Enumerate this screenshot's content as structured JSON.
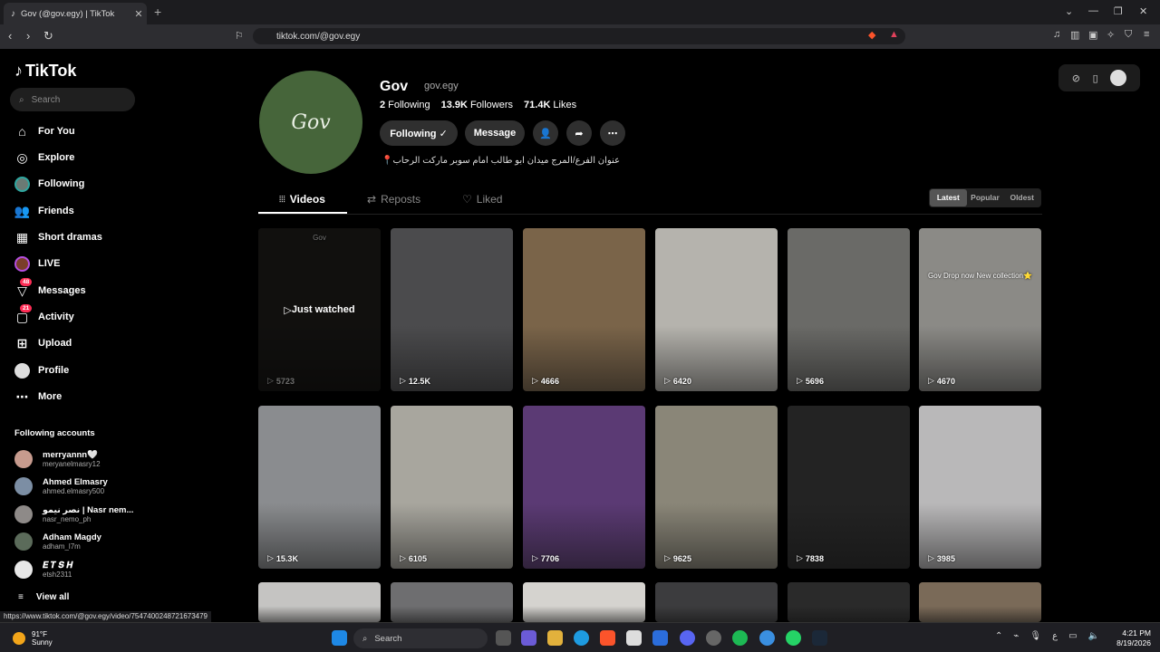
{
  "browser": {
    "tab_title": "Gov (@gov.egy) | TikTok",
    "url": "tiktok.com/@gov.egy"
  },
  "sidebar": {
    "logo": "TikTok",
    "search_placeholder": "Search",
    "nav": [
      {
        "label": "For You",
        "icon": "home-icon"
      },
      {
        "label": "Explore",
        "icon": "compass-icon"
      },
      {
        "label": "Following",
        "icon": "following-avatar-icon"
      },
      {
        "label": "Friends",
        "icon": "friends-icon"
      },
      {
        "label": "Short dramas",
        "icon": "film-icon"
      },
      {
        "label": "LIVE",
        "icon": "live-icon"
      },
      {
        "label": "Messages",
        "icon": "messages-icon",
        "badge": "48"
      },
      {
        "label": "Activity",
        "icon": "activity-icon",
        "badge": "21"
      },
      {
        "label": "Upload",
        "icon": "upload-icon"
      },
      {
        "label": "Profile",
        "icon": "profile-avatar-icon"
      },
      {
        "label": "More",
        "icon": "more-icon"
      }
    ],
    "following_title": "Following accounts",
    "accounts": [
      {
        "name": "merryannn🤍",
        "handle": "meryanelmasry12"
      },
      {
        "name": "Ahmed Elmasry",
        "handle": "ahmed.elmasry500"
      },
      {
        "name": "نصر نيمو | Nasr nem...",
        "handle": "nasr_nemo_ph"
      },
      {
        "name": "Adham Magdy",
        "handle": "adham_l7m"
      },
      {
        "name": "𝑬 𝑻 𝑺 𝑯",
        "handle": "etsh2311"
      }
    ],
    "view_all": "View all"
  },
  "status_url": "https://www.tiktok.com/@gov.egy/video/7547400248721673479",
  "profile": {
    "avatar_text": "Gov",
    "name": "Gov",
    "handle": "gov.egy",
    "following_count": "2",
    "following_label": "Following",
    "followers_count": "13.9K",
    "followers_label": "Followers",
    "likes_count": "71.4K",
    "likes_label": "Likes",
    "btn_following": "Following ✓",
    "btn_message": "Message",
    "bio": "📍عنوان الفرع/المرج ميدان ابو طالب امام سوبر ماركت الرحاب"
  },
  "tabs": {
    "videos": "Videos",
    "reposts": "Reposts",
    "liked": "Liked"
  },
  "sort": {
    "options": [
      "Latest",
      "Popular",
      "Oldest"
    ],
    "active": "Latest"
  },
  "videos": [
    {
      "views": "5723",
      "just_watched": "Just watched",
      "overlay": "Gov",
      "bg": "#262420"
    },
    {
      "views": "12.5K",
      "bg": "#4b4b4d"
    },
    {
      "views": "4666",
      "bg": "#7a6449"
    },
    {
      "views": "6420",
      "bg": "#b5b3ad"
    },
    {
      "views": "5696",
      "bg": "#6a6a67"
    },
    {
      "views": "4670",
      "overlay": "Gov Drop now New collection⭐",
      "bg": "#8b8a86"
    },
    {
      "views": "15.3K",
      "bg": "#8a8c8f"
    },
    {
      "views": "6105",
      "bg": "#a8a69e"
    },
    {
      "views": "7706",
      "bg": "#5b3a74"
    },
    {
      "views": "9625",
      "bg": "#8a8678"
    },
    {
      "views": "7838",
      "bg": "#232323"
    },
    {
      "views": "3985",
      "bg": "#b9b8b9"
    },
    {
      "views": "",
      "bg": "#c5c4c2"
    },
    {
      "views": "",
      "bg": "#6e6e70"
    },
    {
      "views": "",
      "bg": "#d5d3cf"
    },
    {
      "views": "",
      "bg": "#3c3c3e"
    },
    {
      "views": "",
      "bg": "#2a2a2a"
    },
    {
      "views": "",
      "bg": "#7a6a58"
    }
  ],
  "taskbar": {
    "temp": "91°F",
    "weather": "Sunny",
    "search": "Search",
    "time": "4:21 PM",
    "date": "8/19/2026"
  }
}
